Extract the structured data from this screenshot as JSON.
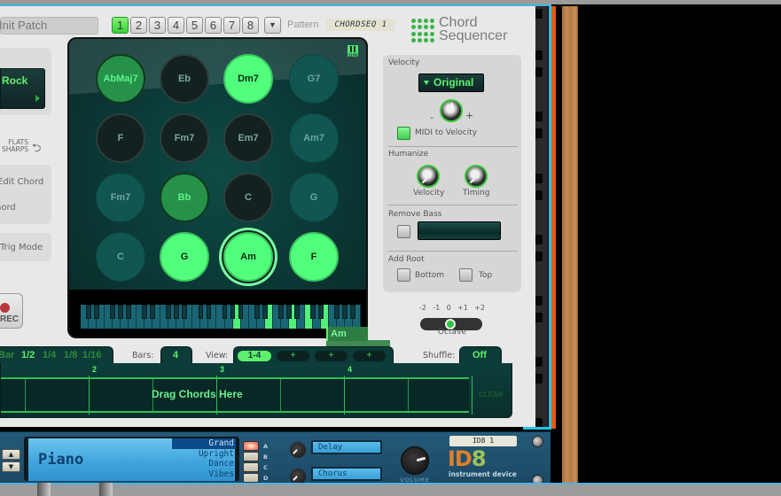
{
  "header": {
    "patch_name": "Init Patch",
    "pattern_buttons": [
      "1",
      "2",
      "3",
      "4",
      "5",
      "6",
      "7",
      "8"
    ],
    "active_pattern": "1",
    "pattern_menu_icon": "triangle-down-icon",
    "pattern_label": "Pattern",
    "pattern_name": "CHORDSEQ 1",
    "logo_line1": "Chord",
    "logo_line2": "Sequencer"
  },
  "left": {
    "scale_display": "Rock",
    "flats_label": "FLATS",
    "sharps_label": "SHARPS",
    "edit_chord_label": "Edit Chord",
    "chord_label": "Chord",
    "trig_mode_label": "Trig Mode",
    "rec_label": "REC"
  },
  "pads": {
    "midi_label": "MIDI",
    "items": [
      {
        "label": "AbMaj7",
        "state": "mid"
      },
      {
        "label": "Eb",
        "state": "dark"
      },
      {
        "label": "Dm7",
        "state": "bright"
      },
      {
        "label": "G7",
        "state": "teal"
      },
      {
        "label": "F",
        "state": "dark"
      },
      {
        "label": "Fm7",
        "state": "dark"
      },
      {
        "label": "Em7",
        "state": "dark"
      },
      {
        "label": "Am7",
        "state": "teal"
      },
      {
        "label": "Fm7",
        "state": "teal"
      },
      {
        "label": "Bb",
        "state": "mid"
      },
      {
        "label": "C",
        "state": "dark"
      },
      {
        "label": "G",
        "state": "teal"
      },
      {
        "label": "C",
        "state": "teal"
      },
      {
        "label": "G",
        "state": "bright"
      },
      {
        "label": "Am",
        "state": "bright",
        "selected": true
      },
      {
        "label": "F",
        "state": "bright"
      }
    ],
    "drag_chord_label": "Am"
  },
  "controls": {
    "velocity_label": "Velocity",
    "velocity_mode": "Original",
    "minus_label": "-",
    "plus_label": "+",
    "midi_to_velocity_label": "MIDI to Velocity",
    "midi_to_velocity_checked": true,
    "humanize_label": "Humanize",
    "humanize_velocity_label": "Velocity",
    "humanize_timing_label": "Timing",
    "remove_bass_label": "Remove Bass",
    "remove_bass_checked": false,
    "add_root_label": "Add Root",
    "bottom_label": "Bottom",
    "bottom_checked": false,
    "top_label": "Top",
    "top_checked": false,
    "octave_ticks": [
      "-2",
      "-1",
      "0",
      "+1",
      "+2"
    ],
    "octave_label": "Octave",
    "octave_value": "0"
  },
  "sequencer": {
    "resolutions": [
      "Bar",
      "1/2",
      "1/4",
      "1/8",
      "1/16"
    ],
    "active_resolution": "1/2",
    "bars_label": "Bars:",
    "bars_value": "4",
    "view_label": "View:",
    "view_options": [
      "1-4",
      "+",
      "+",
      "+"
    ],
    "active_view": "1-4",
    "shuffle_label": "Shuffle:",
    "shuffle_value": "Off",
    "bar_numbers": [
      "2",
      "3",
      "4"
    ],
    "drop_hint": "Drag Chords Here",
    "clear_label": "CLEAR"
  },
  "instrument": {
    "patch_display": "Piano",
    "variants": [
      "Grand",
      "Upright",
      "Dance",
      "Vibes"
    ],
    "selected_variant": "Grand",
    "variant_buttons": [
      "A",
      "B",
      "C",
      "D"
    ],
    "active_variant_button": "A",
    "fx1": "Delay",
    "fx2": "Chorus",
    "volume_label": "VOLUME",
    "device_name": "ID8 1",
    "logo_id": "ID",
    "logo_8": "8",
    "subtitle": "instrument device"
  },
  "colors": {
    "accent_green": "#5ef06c",
    "screen_teal": "#0b2e2c",
    "rack_cyan": "#22c5f5",
    "rack_orange": "#ea5a10",
    "id8_blue": "#245a78"
  }
}
